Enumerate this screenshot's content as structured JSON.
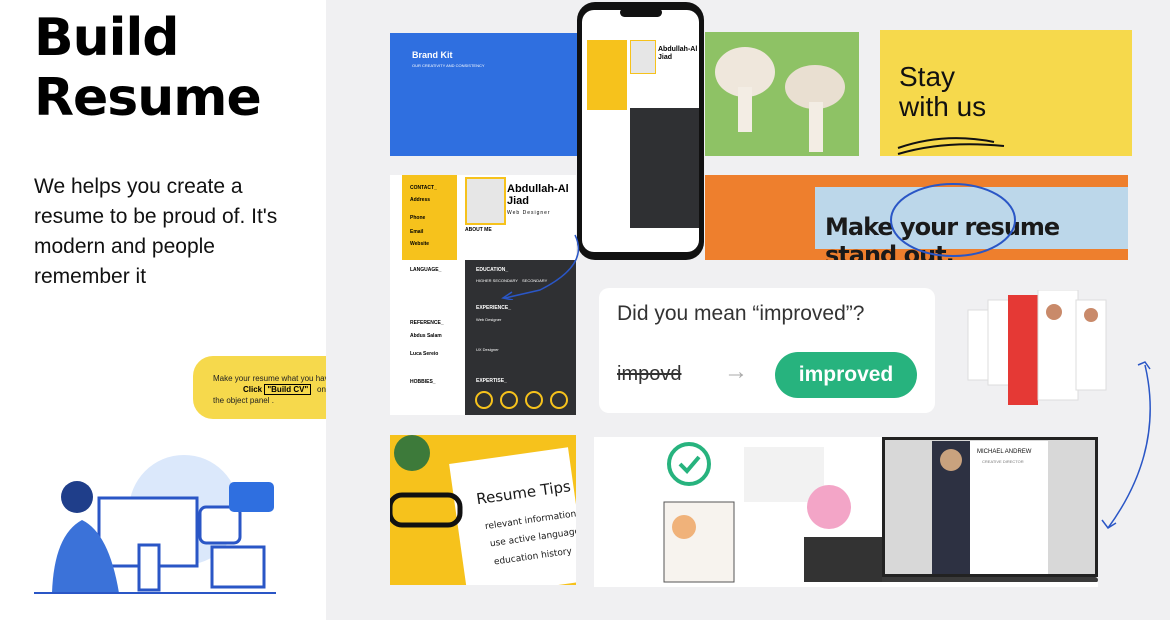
{
  "hero": {
    "title_line1": "Build",
    "title_line2": "Resume",
    "description": "We helps you create a resume to be proud of. It's modern and people remember it"
  },
  "tip": {
    "text": "Make your resume what you have!",
    "cta_prefix": "Click",
    "cta_label": "\"Build CV\"",
    "suffix": "on",
    "suffix2": "the object panel ."
  },
  "gallery": {
    "brand_kit_title": "Brand Kit",
    "brand_kit_subtitle": "OUR CREATIVITY AND CONSISTENCY",
    "stay_line1": "Stay",
    "stay_line2": "with us",
    "banner_text": "Make your resume stand out.",
    "dym_question": "Did you mean “improved”?",
    "dym_wrong": "impovd",
    "dym_correct": "improved",
    "tips_title": "Resume Tips",
    "tips_items": [
      "relevant information",
      "use active language",
      "education history"
    ],
    "laptop_name": "MICHAEL ANDREW",
    "laptop_role": "CREATIVE DIRECTOR"
  },
  "resume": {
    "name": "Abdullah-Al Jiad",
    "role": "Web Designer",
    "contact": "CONTACT_",
    "address_label": "Address",
    "phone_label": "Phone",
    "email_label": "Email",
    "website_label": "Website",
    "about": "ABOUT ME",
    "language": "LANGUAGE_",
    "languages": [
      "Bangla",
      "English",
      "Hindi"
    ],
    "reference": "REFERENCE_",
    "ref1": "Abdus Salam",
    "ref2": "Luca Sereio",
    "hobbies": "HOBBIES_",
    "education": "EDUCATION_",
    "edu1": "HIGHER SECONDARY",
    "edu2": "SECONDARY",
    "experience": "EXPERIENCE_",
    "exp1": "Web Designer",
    "exp2": "UX Designer",
    "expertise": "EXPERTISE_"
  },
  "colors": {
    "accent_yellow": "#f6d94c",
    "brand_blue": "#2f6fe0",
    "green": "#27b37e",
    "orange": "#ee7f2d",
    "dark_panel": "#2f3033"
  }
}
